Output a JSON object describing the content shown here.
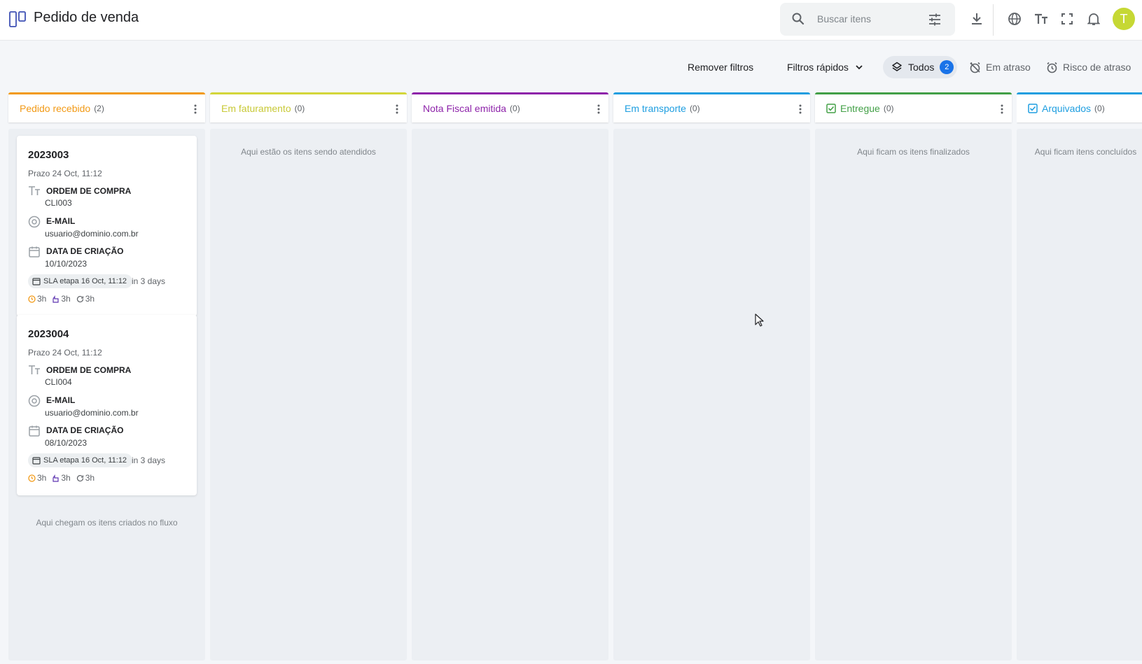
{
  "header": {
    "title": "Pedido de venda",
    "search_placeholder": "Buscar itens",
    "avatar_initial": "T"
  },
  "toolbar": {
    "remove_filters": "Remover filtros",
    "quick_filters": "Filtros rápidos",
    "todos_label": "Todos",
    "todos_count": "2",
    "late": "Em atraso",
    "late_risk": "Risco de atraso"
  },
  "columns": [
    {
      "title": "Pedido recebido",
      "count": "(2)",
      "color": "#f29a16",
      "footer": "Aqui chegam os itens criados no fluxo"
    },
    {
      "title": "Em faturamento",
      "count": "(0)",
      "color": "#d3d63a",
      "empty": "Aqui estão os itens sendo atendidos"
    },
    {
      "title": "Nota Fiscal emitida",
      "count": "(0)",
      "color": "#8e24aa",
      "empty": ""
    },
    {
      "title": "Em transporte",
      "count": "(0)",
      "color": "#1e9ee0",
      "empty": ""
    },
    {
      "title": "Entregue",
      "count": "(0)",
      "color": "#43a047",
      "empty": "Aqui ficam os itens finalizados"
    },
    {
      "title": "Arquivados",
      "count": "(0)",
      "color": "#1e9ee0",
      "empty": "Aqui ficam itens concluídos"
    }
  ],
  "cards": [
    {
      "code": "2023003",
      "prazo": "Prazo 24 Oct, 11:12",
      "field1_label": "ORDEM DE COMPRA",
      "field1_value": "CLI003",
      "field2_label": "E-MAIL",
      "field2_value": "usuario@dominio.com.br",
      "field3_label": "DATA DE CRIAÇÃO",
      "field3_value": "10/10/2023",
      "sla": "SLA etapa 16 Oct, 11:12",
      "in_days": "in 3 days",
      "m1": "3h",
      "m2": "3h",
      "m3": "3h"
    },
    {
      "code": "2023004",
      "prazo": "Prazo 24 Oct, 11:12",
      "field1_label": "ORDEM DE COMPRA",
      "field1_value": "CLI004",
      "field2_label": "E-MAIL",
      "field2_value": "usuario@dominio.com.br",
      "field3_label": "DATA DE CRIAÇÃO",
      "field3_value": "08/10/2023",
      "sla": "SLA etapa 16 Oct, 11:12",
      "in_days": "in 3 days",
      "m1": "3h",
      "m2": "3h",
      "m3": "3h"
    }
  ],
  "icons": {
    "app": "kanban-board-icon",
    "search": "search-icon",
    "tune": "tune-icon",
    "download": "download-icon",
    "globe": "globe-icon",
    "text_size": "text-size-icon",
    "fullscreen": "fullscreen-icon",
    "bell": "bell-icon"
  }
}
